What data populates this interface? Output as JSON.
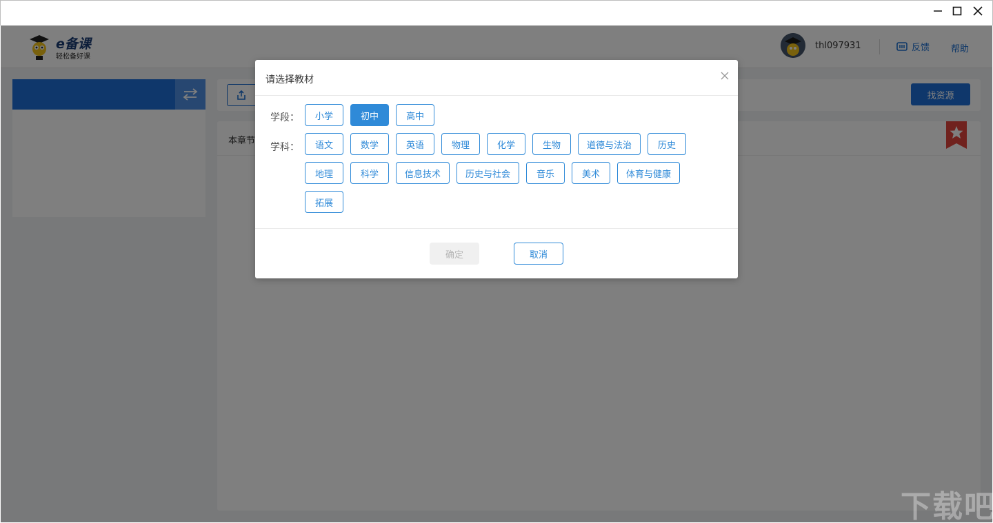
{
  "window": {
    "minimize_icon": "minimize-icon",
    "maximize_icon": "maximize-icon",
    "close_icon": "close-icon"
  },
  "header": {
    "logo_title": "e备课",
    "logo_subtitle": "轻松备好课",
    "username": "thl097931",
    "feedback_label": "反馈",
    "help_label": "帮助"
  },
  "toolbar": {
    "find_resources_label": "找资源"
  },
  "content": {
    "chapter_label": "本章节"
  },
  "dialog": {
    "title": "请选择教材",
    "stage_label": "学段：",
    "subject_label": "学科：",
    "stages": [
      {
        "label": "小学",
        "active": false
      },
      {
        "label": "初中",
        "active": true
      },
      {
        "label": "高中",
        "active": false
      }
    ],
    "subjects_row1": [
      "语文",
      "数学",
      "英语",
      "物理",
      "化学",
      "生物",
      "道德与法治",
      "历史"
    ],
    "subjects_row2": [
      "地理",
      "科学",
      "信息技术",
      "历史与社会",
      "音乐",
      "美术",
      "体育与健康"
    ],
    "subjects_row3": [
      "拓展"
    ],
    "confirm_label": "确定",
    "cancel_label": "取消"
  },
  "colors": {
    "primary": "#1f6fd6",
    "chip_blue": "#2f8ad8",
    "bookmark_red": "#e0453c"
  },
  "watermark": "下载吧"
}
